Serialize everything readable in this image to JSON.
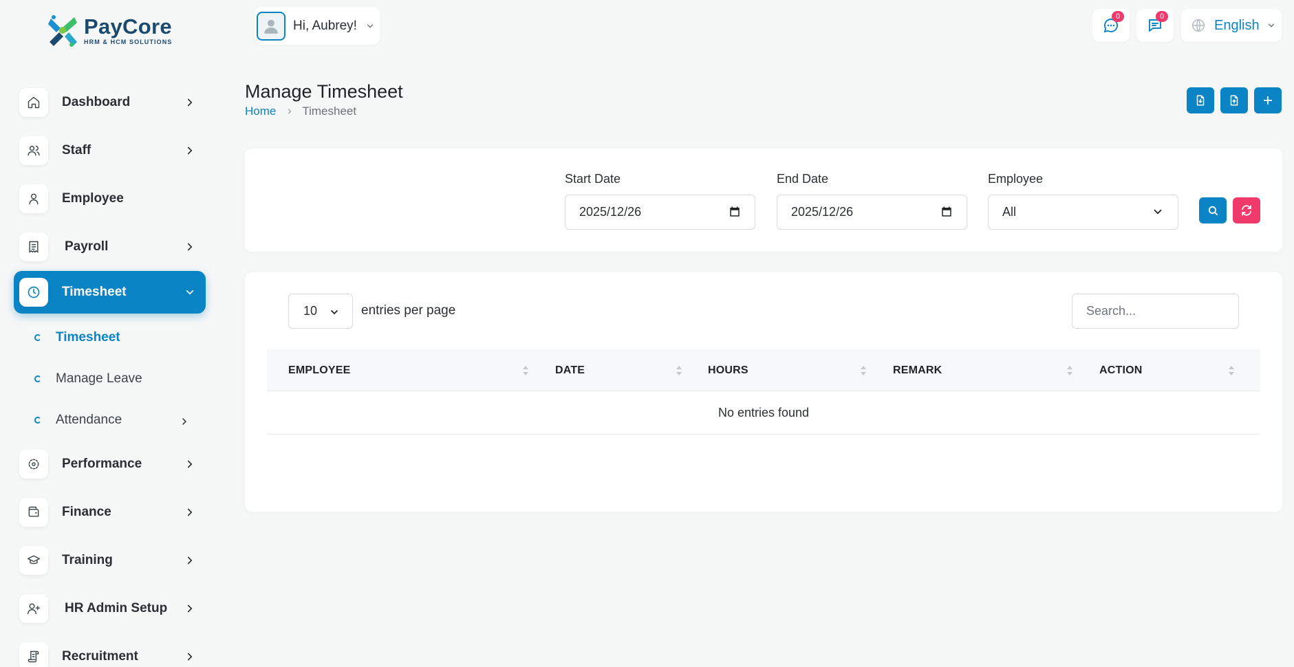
{
  "brand": {
    "name": "PayCore",
    "tagline": "HRM & HCM SOLUTIONS",
    "colors": {
      "primary": "#0a84c4",
      "danger": "#f03a6b",
      "brand_dark": "#1c4a6e"
    }
  },
  "topbar": {
    "greeting": "Hi, Aubrey!",
    "messages_count": "0",
    "notifications_count": "0",
    "language": "English"
  },
  "sidebar": {
    "items": [
      {
        "label": "Dashboard",
        "icon": "home-icon"
      },
      {
        "label": "Staff",
        "icon": "users-icon"
      },
      {
        "label": "Employee",
        "icon": "user-icon"
      },
      {
        "label": "Payroll",
        "icon": "receipt-icon"
      },
      {
        "label": "Timesheet",
        "icon": "clock-icon",
        "active": true
      },
      {
        "label": "Performance",
        "icon": "target-icon"
      },
      {
        "label": "Finance",
        "icon": "wallet-icon"
      },
      {
        "label": "Training",
        "icon": "graduation-cap-icon"
      },
      {
        "label": "HR Admin Setup",
        "icon": "user-plus-icon"
      },
      {
        "label": "Recruitment",
        "icon": "scroll-icon"
      }
    ],
    "timesheet_sub": [
      {
        "label": "Timesheet",
        "active": true
      },
      {
        "label": "Manage Leave"
      },
      {
        "label": "Attendance"
      }
    ]
  },
  "page": {
    "title": "Manage Timesheet",
    "breadcrumb": {
      "home": "Home",
      "current": "Timesheet"
    }
  },
  "filters": {
    "start_date": {
      "label": "Start Date",
      "value": "2025/12/26"
    },
    "end_date": {
      "label": "End Date",
      "value": "2025/12/26"
    },
    "employee": {
      "label": "Employee",
      "value": "All"
    }
  },
  "table": {
    "per_page": "10",
    "per_page_label": "entries per page",
    "search_placeholder": "Search...",
    "columns": [
      "EMPLOYEE",
      "DATE",
      "HOURS",
      "REMARK",
      "ACTION"
    ],
    "empty_text": "No entries found"
  }
}
